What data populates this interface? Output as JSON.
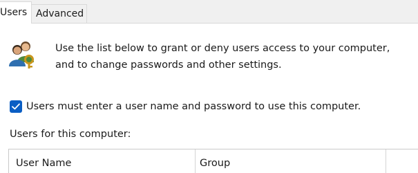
{
  "tabs": [
    {
      "label": "Users",
      "selected": true
    },
    {
      "label": "Advanced",
      "selected": false
    }
  ],
  "intro": {
    "icon": "users-icon",
    "line1": "Use the list below to grant or deny users access to your computer,",
    "line2": "and to change passwords and other settings."
  },
  "require_login": {
    "checked": true,
    "label": "Users must enter a user name and password to use this computer."
  },
  "users_list": {
    "label": "Users for this computer:",
    "columns": [
      "User Name",
      "Group"
    ]
  },
  "colors": {
    "accent": "#0a5ec4",
    "tab_background": "#f0f0f0",
    "border": "#c9c9c9"
  }
}
